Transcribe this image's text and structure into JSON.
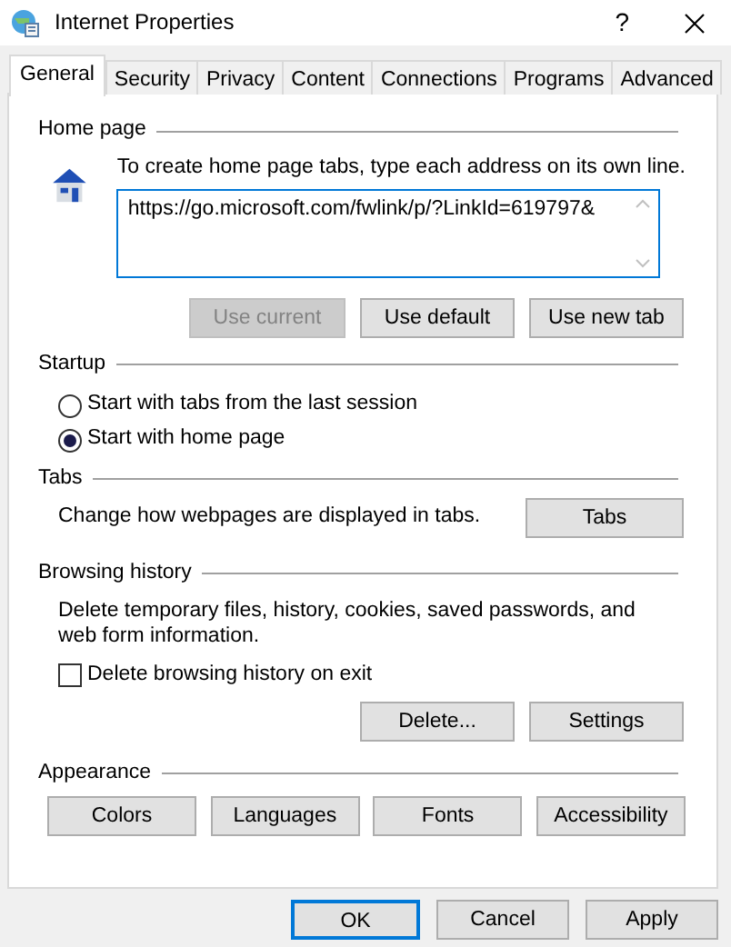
{
  "window": {
    "title": "Internet Properties",
    "help": "?"
  },
  "tabs": [
    {
      "label": "General",
      "selected": true
    },
    {
      "label": "Security",
      "selected": false
    },
    {
      "label": "Privacy",
      "selected": false
    },
    {
      "label": "Content",
      "selected": false
    },
    {
      "label": "Connections",
      "selected": false
    },
    {
      "label": "Programs",
      "selected": false
    },
    {
      "label": "Advanced",
      "selected": false
    }
  ],
  "home_page": {
    "legend": "Home page",
    "instruction": "To create home page tabs, type each address on its own line.",
    "address": "https://go.microsoft.com/fwlink/p/?LinkId=619797&",
    "buttons": [
      {
        "label": "Use current",
        "disabled": true
      },
      {
        "label": "Use default",
        "disabled": false
      },
      {
        "label": "Use new tab",
        "disabled": false
      }
    ]
  },
  "startup": {
    "legend": "Startup",
    "options": [
      {
        "label": "Start with tabs from the last session",
        "selected": false
      },
      {
        "label": "Start with home page",
        "selected": true
      }
    ]
  },
  "tabs_group": {
    "legend": "Tabs",
    "description": "Change how webpages are displayed in tabs.",
    "button": "Tabs"
  },
  "browsing_history": {
    "legend": "Browsing history",
    "description": "Delete temporary files, history, cookies, saved passwords, and web form information.",
    "checkbox": {
      "label": "Delete browsing history on exit",
      "checked": false
    },
    "buttons": [
      "Delete...",
      "Settings"
    ]
  },
  "appearance": {
    "legend": "Appearance",
    "buttons": [
      "Colors",
      "Languages",
      "Fonts",
      "Accessibility"
    ]
  },
  "footer_buttons": [
    {
      "label": "OK",
      "focused": true
    },
    {
      "label": "Cancel",
      "focused": false
    },
    {
      "label": "Apply",
      "focused": false
    }
  ]
}
